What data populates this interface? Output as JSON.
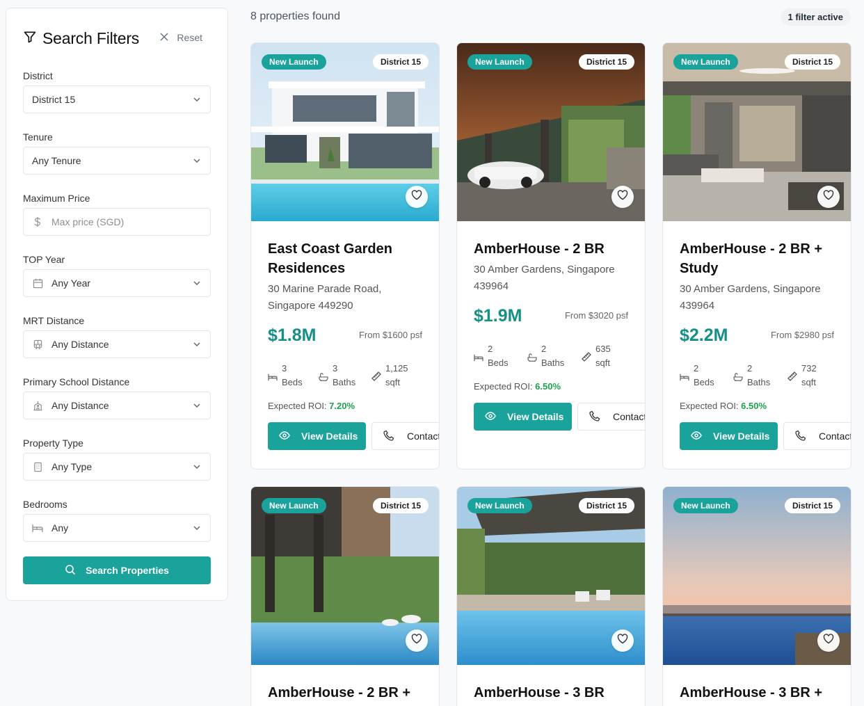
{
  "sidebar": {
    "title": "Search Filters",
    "reset_label": "Reset",
    "fields": {
      "district": {
        "label": "District",
        "value": "District 15"
      },
      "tenure": {
        "label": "Tenure",
        "value": "Any Tenure"
      },
      "max_price": {
        "label": "Maximum Price",
        "placeholder": "Max price (SGD)"
      },
      "top_year": {
        "label": "TOP Year",
        "value": "Any Year"
      },
      "mrt": {
        "label": "MRT Distance",
        "value": "Any Distance"
      },
      "school": {
        "label": "Primary School Distance",
        "value": "Any Distance"
      },
      "type": {
        "label": "Property Type",
        "value": "Any Type"
      },
      "bedrooms": {
        "label": "Bedrooms",
        "value": "Any"
      }
    },
    "search_label": "Search Properties"
  },
  "results": {
    "count_text": "8 properties found",
    "filter_badge": "1 filter active"
  },
  "colors": {
    "accent": "#1aa39a",
    "price": "#168f87",
    "roi": "#1ca34d"
  },
  "cards": [
    {
      "badge_new": "New Launch",
      "badge_district": "District 15",
      "title": "East Coast Garden Residences",
      "address": "30 Marine Parade Road, Singapore 449290",
      "price": "$1.8M",
      "psf": "From $1600 psf",
      "beds": "3",
      "beds_label": "Beds",
      "baths": "3",
      "baths_label": "Baths",
      "sqft": "1,125",
      "sqft_label": "sqft",
      "roi_label": "Expected ROI:",
      "roi": "7.20%",
      "view_label": "View Details",
      "contact_label": "Contact"
    },
    {
      "badge_new": "New Launch",
      "badge_district": "District 15",
      "title": "AmberHouse - 2 BR",
      "address": "30 Amber Gardens, Singapore 439964",
      "price": "$1.9M",
      "psf": "From $3020 psf",
      "beds": "2",
      "beds_label": "Beds",
      "baths": "2",
      "baths_label": "Baths",
      "sqft": "635",
      "sqft_label": "sqft",
      "roi_label": "Expected ROI:",
      "roi": "6.50%",
      "view_label": "View Details",
      "contact_label": "Contact"
    },
    {
      "badge_new": "New Launch",
      "badge_district": "District 15",
      "title": "AmberHouse - 2 BR + Study",
      "address": "30 Amber Gardens, Singapore 439964",
      "price": "$2.2M",
      "psf": "From $2980 psf",
      "beds": "2",
      "beds_label": "Beds",
      "baths": "2",
      "baths_label": "Baths",
      "sqft": "732",
      "sqft_label": "sqft",
      "roi_label": "Expected ROI:",
      "roi": "6.50%",
      "view_label": "View Details",
      "contact_label": "Contact"
    },
    {
      "badge_new": "New Launch",
      "badge_district": "District 15",
      "title": "AmberHouse - 2 BR +"
    },
    {
      "badge_new": "New Launch",
      "badge_district": "District 15",
      "title": "AmberHouse - 3 BR"
    },
    {
      "badge_new": "New Launch",
      "badge_district": "District 15",
      "title": "AmberHouse - 3 BR +"
    }
  ]
}
